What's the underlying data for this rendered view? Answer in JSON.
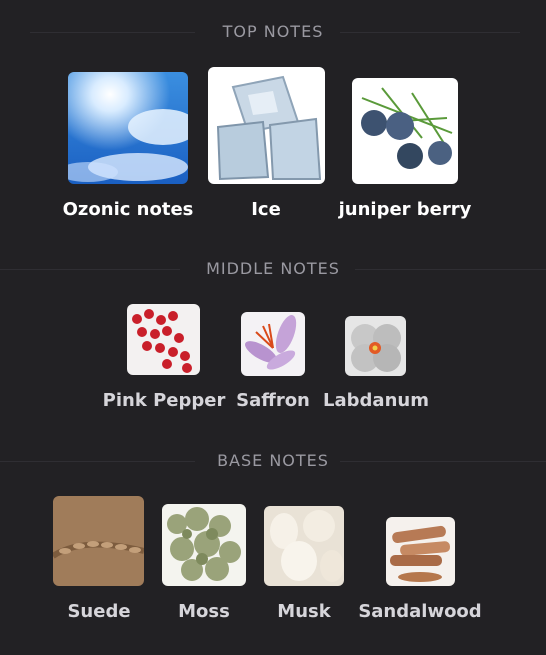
{
  "sections": {
    "top": {
      "title": "TOP NOTES",
      "notes": [
        {
          "label": "Ozonic notes",
          "icon": "sky-clouds-icon"
        },
        {
          "label": "Ice",
          "icon": "ice-cubes-icon"
        },
        {
          "label": "juniper berry",
          "icon": "juniper-berry-icon"
        }
      ]
    },
    "middle": {
      "title": "MIDDLE NOTES",
      "notes": [
        {
          "label": "Pink Pepper",
          "icon": "pink-pepper-icon"
        },
        {
          "label": "Saffron",
          "icon": "saffron-flower-icon"
        },
        {
          "label": "Labdanum",
          "icon": "labdanum-flower-icon"
        }
      ]
    },
    "base": {
      "title": "BASE NOTES",
      "notes": [
        {
          "label": "Suede",
          "icon": "suede-leather-icon"
        },
        {
          "label": "Moss",
          "icon": "moss-icon"
        },
        {
          "label": "Musk",
          "icon": "musk-fur-icon"
        },
        {
          "label": "Sandalwood",
          "icon": "sandalwood-sticks-icon"
        }
      ]
    }
  },
  "colors": {
    "background": "#222124",
    "section_title": "#9a99a1",
    "top_label": "#ffffff",
    "middle_base_label": "#d6d5da"
  }
}
